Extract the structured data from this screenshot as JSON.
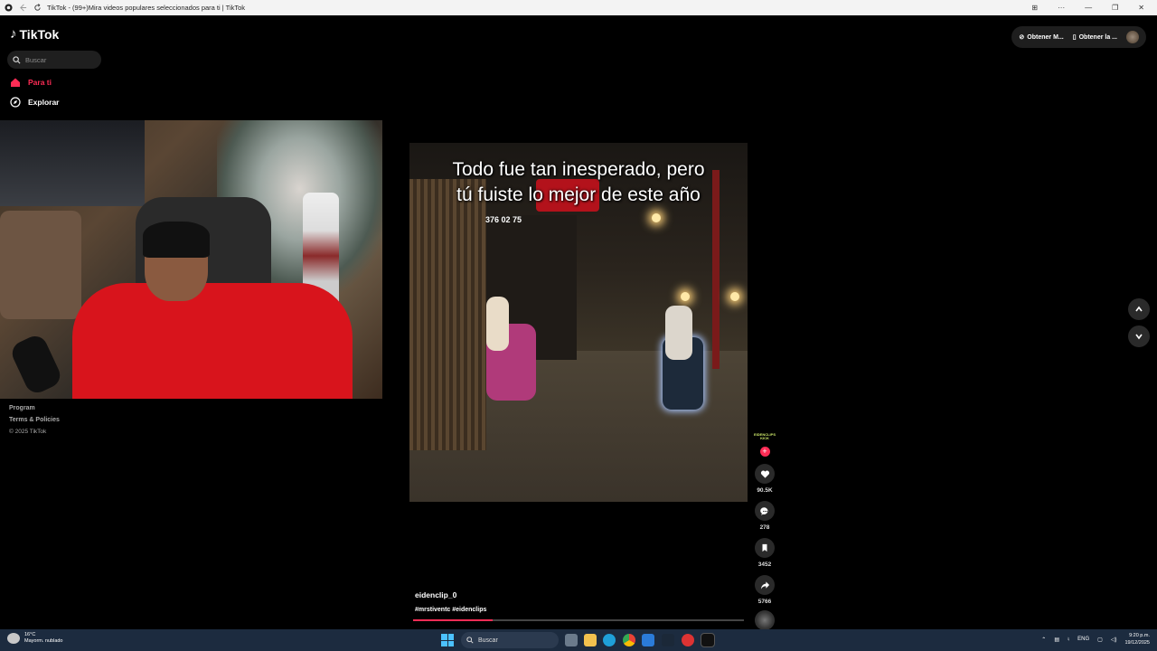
{
  "browser": {
    "tab_title": "TikTok - (99+)Mira videos populares seleccionados para ti | TikTok"
  },
  "sidebar": {
    "logo_text": "TikTok",
    "search_placeholder": "Buscar",
    "items": [
      {
        "label": "Para ti",
        "icon": "home-icon",
        "active": true
      },
      {
        "label": "Explorar",
        "icon": "compass-icon",
        "active": false
      }
    ],
    "footer": {
      "program": "Program",
      "terms": "Terms & Policies",
      "copyright": "© 2025 TikTok"
    }
  },
  "header": {
    "get_app_1": "Obtener M...",
    "get_app_2": "Obtener la ..."
  },
  "video": {
    "caption_line1": "Todo fue tan inesperado, pero",
    "caption_line2": "tú fuiste lo mejor de este año",
    "sign_text": "376 02 75",
    "author": "eidenclip_0",
    "hashtags": "#mrstiventc #eidenclips",
    "progress_fraction": 0.24,
    "creator_badge": "EIDENCLIPS\nKICK"
  },
  "actions": {
    "likes": "90.5K",
    "comments": "278",
    "saves": "3452",
    "shares": "5766"
  },
  "taskbar": {
    "temperature": "16°C",
    "weather_desc": "Mayorm. nublado",
    "search_label": "Buscar",
    "language": "ENG",
    "time": "9:20 p.m.",
    "date": "19/12/2025"
  },
  "colors": {
    "accent": "#fe2c55",
    "background": "#000000"
  }
}
